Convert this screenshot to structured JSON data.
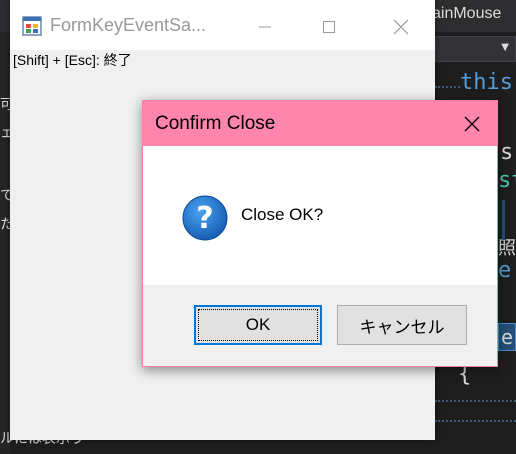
{
  "background_ide": {
    "tab_text": "ainMouse",
    "left_strip_chars": [
      "可",
      "ェ",
      "で",
      "た"
    ],
    "code_fragments": {
      "this": "this",
      "s": "s",
      "st": "st",
      "kanji": "照",
      "e": "e",
      "brace": "{",
      "e_highlight": "e"
    },
    "bottom_text": "ルには表示う"
  },
  "form": {
    "title": "FormKeyEventSa...",
    "label": "[Shift] + [Esc]: 終了"
  },
  "dialog": {
    "title": "Confirm Close",
    "message": "Close OK?",
    "ok_label": "OK",
    "cancel_label": "キャンセル"
  },
  "colors": {
    "dialog_titlebar": "#ff85ad",
    "dialog_border": "#ff7eab",
    "ok_focus": "#0078d7",
    "question_icon": "#1c6fc6"
  }
}
